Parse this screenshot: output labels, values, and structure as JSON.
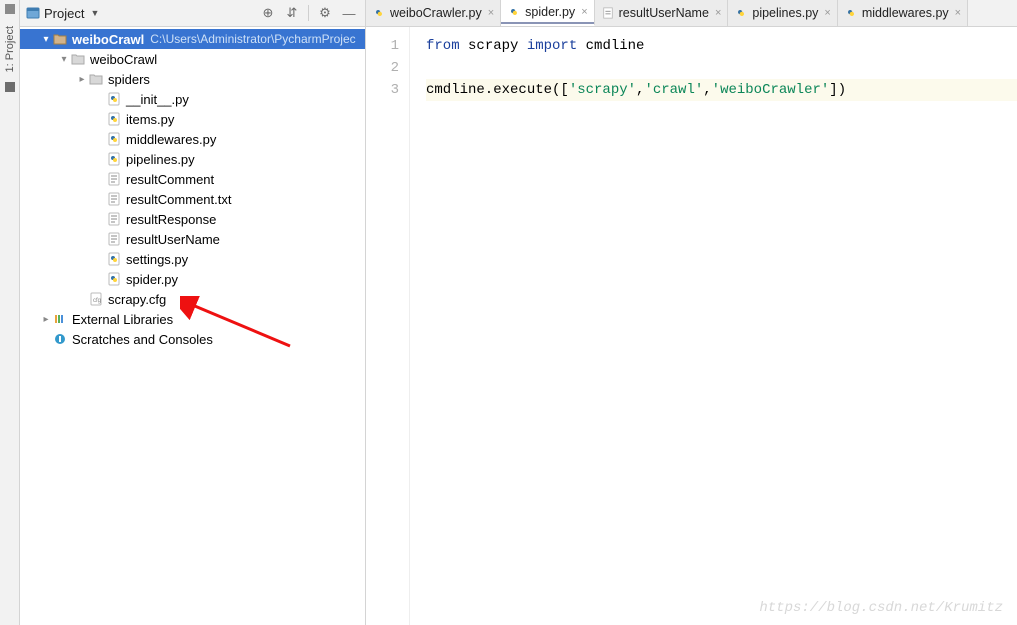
{
  "rail": {
    "label": "1: Project"
  },
  "panel": {
    "title": "Project",
    "buttons": {
      "target": "⊕",
      "expand": "⇵",
      "gear": "⚙",
      "hide": "—"
    }
  },
  "tree": {
    "root": {
      "name": "weiboCrawl",
      "path": "C:\\Users\\Administrator\\PycharmProjec"
    },
    "pkg": "weiboCrawl",
    "spiders": "spiders",
    "files": {
      "init": "__init__.py",
      "items": "items.py",
      "middlewares": "middlewares.py",
      "pipelines": "pipelines.py",
      "resultComment": "resultComment",
      "resultCommentTxt": "resultComment.txt",
      "resultResponse": "resultResponse",
      "resultUserName": "resultUserName",
      "settings": "settings.py",
      "spider": "spider.py",
      "scrapycfg": "scrapy.cfg"
    },
    "extlib": "External Libraries",
    "scratches": "Scratches and Consoles"
  },
  "tabs": [
    {
      "label": "weiboCrawler.py",
      "kind": "py",
      "active": false
    },
    {
      "label": "spider.py",
      "kind": "py",
      "active": true
    },
    {
      "label": "resultUserName",
      "kind": "txt",
      "active": false
    },
    {
      "label": "pipelines.py",
      "kind": "py",
      "active": false
    },
    {
      "label": "middlewares.py",
      "kind": "py",
      "active": false
    }
  ],
  "code": {
    "line1": {
      "kw1": "from",
      "m1": " scrapy ",
      "kw2": "import",
      "m2": " cmdline"
    },
    "line3_pre": "cmdline.execute([",
    "line3_s1": "'scrapy'",
    "line3_c1": ",",
    "line3_s2": "'crawl'",
    "line3_c2": ",",
    "line3_s3": "'weiboCrawler'",
    "line3_post": "])"
  },
  "gutter": [
    "1",
    "2",
    "3"
  ],
  "watermark": "https://blog.csdn.net/Krumitz"
}
